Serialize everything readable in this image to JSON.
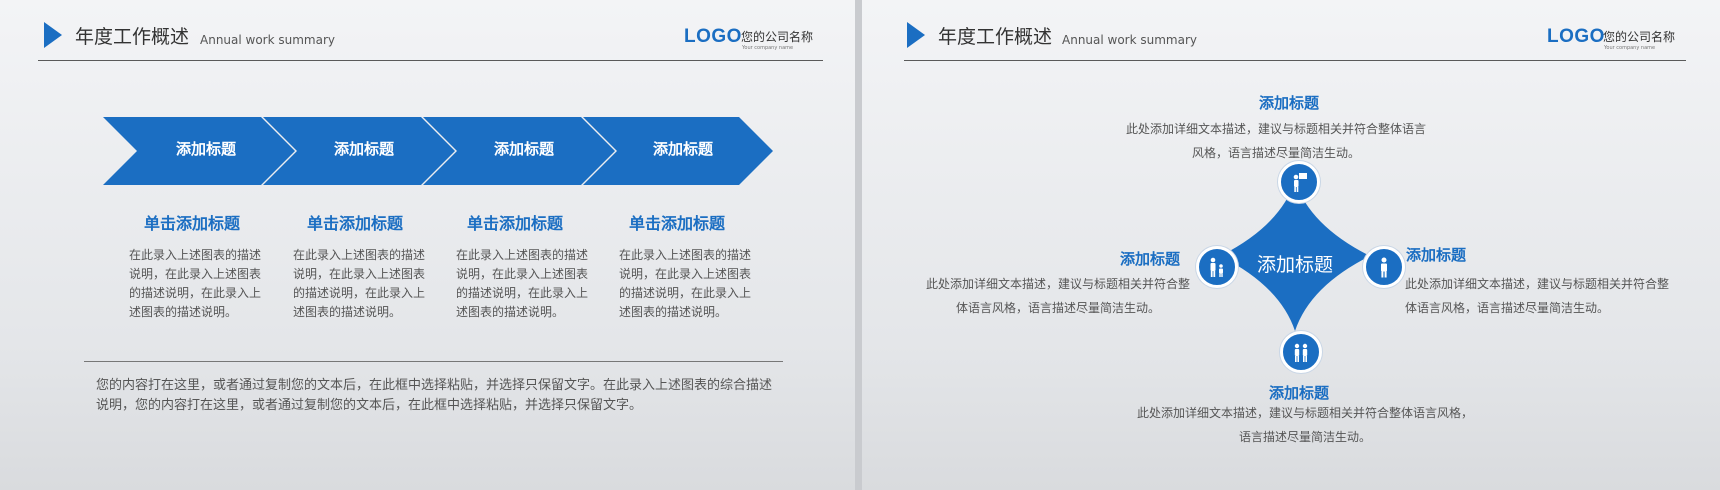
{
  "left": {
    "header": {
      "title": "年度工作概述",
      "subtitle": "Annual work summary",
      "logo": "LOGO",
      "company": "您的公司名称",
      "company_en": "Your company name"
    },
    "steps": [
      {
        "label": "添加标题",
        "title": "单击添加标题",
        "desc": "在此录入上述图表的描述说明，在此录入上述图表的描述说明，在此录入上述图表的描述说明。"
      },
      {
        "label": "添加标题",
        "title": "单击添加标题",
        "desc": "在此录入上述图表的描述说明，在此录入上述图表的描述说明，在此录入上述图表的描述说明。"
      },
      {
        "label": "添加标题",
        "title": "单击添加标题",
        "desc": "在此录入上述图表的描述说明，在此录入上述图表的描述说明，在此录入上述图表的描述说明。"
      },
      {
        "label": "添加标题",
        "title": "单击添加标题",
        "desc": "在此录入上述图表的描述说明，在此录入上述图表的描述说明，在此录入上述图表的描述说明。"
      }
    ],
    "bottom_text": "您的内容打在这里，或者通过复制您的文本后，在此框中选择粘贴，并选择只保留文字。在此录入上述图表的综合描述说明，您的内容打在这里，或者通过复制您的文本后，在此框中选择粘贴，并选择只保留文字。"
  },
  "right": {
    "header": {
      "title": "年度工作概述",
      "subtitle": "Annual work summary",
      "logo": "LOGO",
      "company": "您的公司名称",
      "company_en": "Your company name"
    },
    "center_label": "添加标题",
    "top": {
      "title": "添加标题",
      "desc": "此处添加详细文本描述，建议与标题相关并符合整体语言风格，语言描述尽量简洁生动。"
    },
    "left": {
      "title": "添加标题",
      "desc": "此处添加详细文本描述，建议与标题相关并符合整体语言风格，语言描述尽量简洁生动。"
    },
    "right": {
      "title": "添加标题",
      "desc": "此处添加详细文本描述，建议与标题相关并符合整体语言风格，语言描述尽量简洁生动。"
    },
    "bottom": {
      "title": "添加标题",
      "desc": "此处添加详细文本描述，建议与标题相关并符合整体语言风格，语言描述尽量简洁生动。"
    },
    "icons": [
      "presenter-icon",
      "family-icon",
      "person-icon",
      "parent-child-icon"
    ]
  },
  "colors": {
    "accent": "#1b6ec2",
    "text": "#555555",
    "heading": "#333333"
  }
}
